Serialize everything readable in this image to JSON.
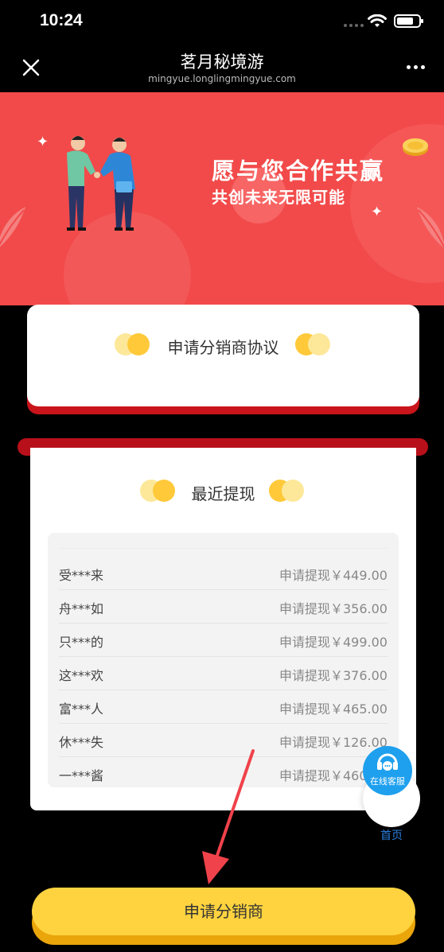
{
  "status": {
    "time": "10:24"
  },
  "nav": {
    "title": "茗月秘境游",
    "subtitle": "mingyue.longlingmingyue.com"
  },
  "banner": {
    "title": "愿与您合作共赢",
    "subtitle": "共创未来无限可能"
  },
  "agreement": {
    "label": "申请分销商协议"
  },
  "withdrawals": {
    "title": "最近提现",
    "rows": [
      {
        "name": "受***来",
        "amount": "申请提现￥449.00"
      },
      {
        "name": "舟***如",
        "amount": "申请提现￥356.00"
      },
      {
        "name": "只***的",
        "amount": "申请提现￥499.00"
      },
      {
        "name": "这***欢",
        "amount": "申请提现￥376.00"
      },
      {
        "name": "富***人",
        "amount": "申请提现￥465.00"
      },
      {
        "name": "休***失",
        "amount": "申请提现￥126.00"
      },
      {
        "name": "一***酱",
        "amount": "申请提现￥460.00"
      }
    ]
  },
  "float": {
    "service_label": "在线客服",
    "home_label": "首页"
  },
  "bottom": {
    "apply_label": "申请分销商"
  },
  "colors": {
    "banner_red": "#f24a4a",
    "accent_yellow": "#ffd33f",
    "dark_red": "#c9141b",
    "service_blue": "#1ea0ee"
  }
}
